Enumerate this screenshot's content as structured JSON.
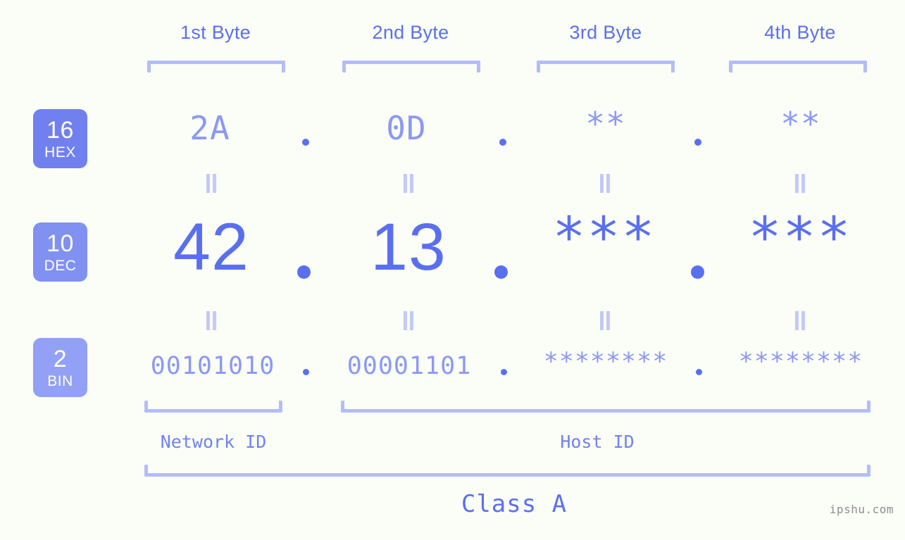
{
  "page": {
    "background": "#fbfdf7",
    "accent_strong": "#5a6ff0",
    "accent_mid": "#8a99f6",
    "accent_light": "#b3bdf9",
    "watermark": "ipshu.com"
  },
  "headers": {
    "bytes": [
      {
        "label": "1st Byte"
      },
      {
        "label": "2nd Byte"
      },
      {
        "label": "3rd Byte"
      },
      {
        "label": "4th Byte"
      }
    ]
  },
  "bases": [
    {
      "num": "16",
      "name": "HEX",
      "color": "#7180ef"
    },
    {
      "num": "10",
      "name": "DEC",
      "color": "#8191f2"
    },
    {
      "num": "2",
      "name": "BIN",
      "color": "#92a0f6"
    }
  ],
  "rows": {
    "hex": {
      "values": [
        "2A",
        "0D",
        "**",
        "**"
      ]
    },
    "dec": {
      "values": [
        "42",
        "13",
        "***",
        "***"
      ]
    },
    "bin": {
      "values": [
        "00101010",
        "00001101",
        "********",
        "********"
      ]
    }
  },
  "separators": {
    "hex": [
      ".",
      ".",
      "."
    ],
    "dec": [
      ".",
      ".",
      "."
    ],
    "bin": [
      ".",
      ".",
      "."
    ]
  },
  "equality": {
    "symbol": "‖"
  },
  "footer": {
    "network_id": "Network ID",
    "host_id": "Host ID",
    "class": "Class A"
  }
}
